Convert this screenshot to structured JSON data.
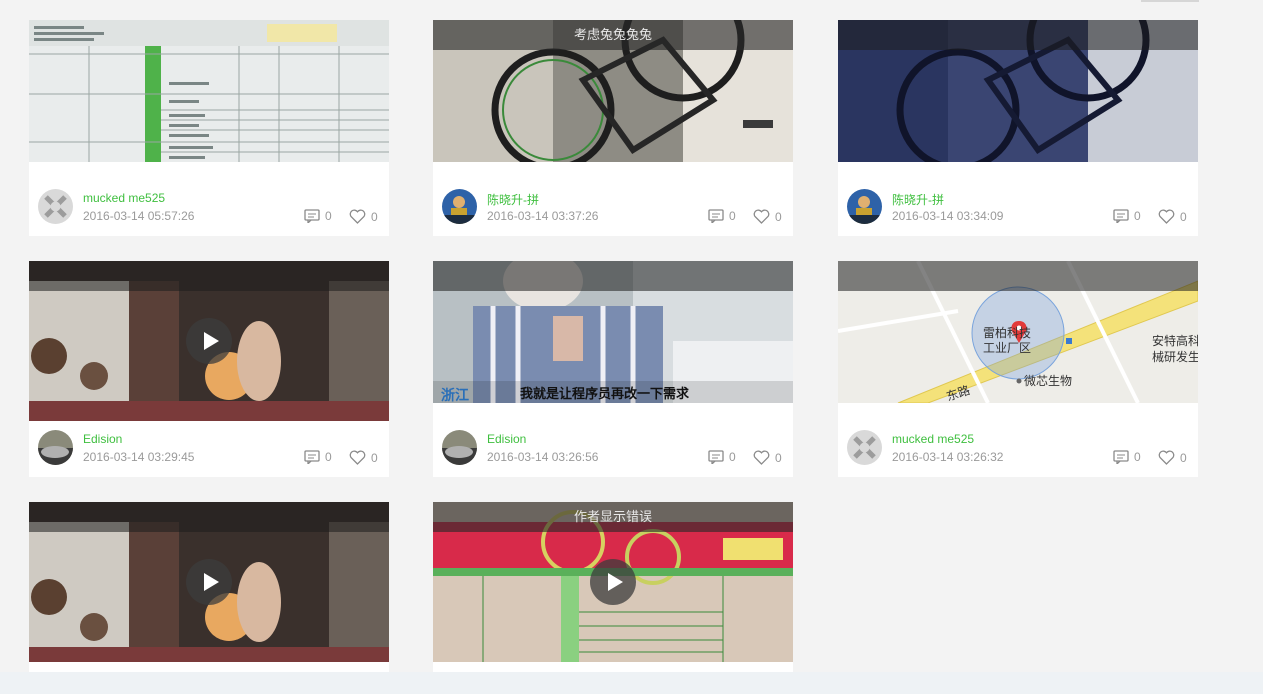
{
  "cards": [
    {
      "caption": "",
      "author": "mucked me525",
      "date": "2016-03-14 05:57:26",
      "comments": "0",
      "likes": "0",
      "avatar": "default",
      "video": false
    },
    {
      "caption": "考虑兔兔兔兔",
      "author": "陈晓升-拼",
      "date": "2016-03-14 03:37:26",
      "comments": "0",
      "likes": "0",
      "avatar": "photo",
      "video": false
    },
    {
      "caption": "",
      "author": "陈晓升-拼",
      "date": "2016-03-14 03:34:09",
      "comments": "0",
      "likes": "0",
      "avatar": "photo",
      "video": false
    },
    {
      "caption": "",
      "author": "Edision",
      "date": "2016-03-14 03:29:45",
      "comments": "0",
      "likes": "0",
      "avatar": "car",
      "video": true
    },
    {
      "caption": "",
      "author": "Edision",
      "date": "2016-03-14 03:26:56",
      "comments": "0",
      "likes": "0",
      "avatar": "car",
      "video": false,
      "subtitle_left": "浙江",
      "subtitle": "我就是让程序员再改一下需求"
    },
    {
      "caption": "",
      "author": "mucked me525",
      "date": "2016-03-14 03:26:32",
      "comments": "0",
      "likes": "0",
      "avatar": "default",
      "video": false,
      "map_labels": [
        "雷柏科技",
        "工业厂区",
        "微芯生物",
        "安特高科",
        "械研发生",
        "东路"
      ]
    },
    {
      "caption": "",
      "video": true
    },
    {
      "caption": "作者显示错误",
      "video": true
    }
  ],
  "colors": {
    "author": "#3fbf3f",
    "meta": "#9a9a9a",
    "background": "#f3f3f3"
  }
}
